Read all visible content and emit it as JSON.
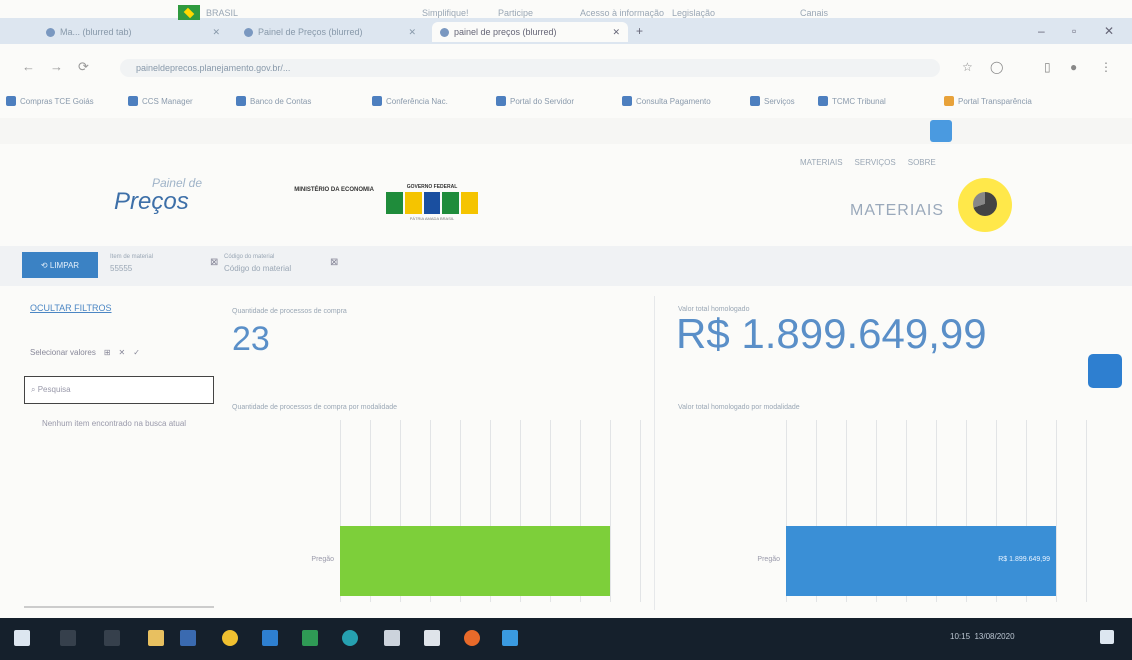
{
  "browser": {
    "tabs": [
      {
        "label": "Ma... (blurred tab)",
        "active": false
      },
      {
        "label": "Painel de Preços (blurred)",
        "active": false
      },
      {
        "label": "painel de preços (blurred)",
        "active": true
      }
    ],
    "url": "paineldeprecos.planejamento.gov.br/...",
    "bookmarks": [
      "Compras TCE Goiás",
      "CCS Manager",
      "Banco de Contas",
      "Conferência Nac.",
      "Portal do Servidor",
      "Consulta Pagamento",
      "Serviços",
      "TCMC Tribunal",
      "Portal Transparência"
    ]
  },
  "gov_bar": {
    "country_label": "BRASIL",
    "links": [
      "Simplifique!",
      "Participe",
      "Acesso à informação",
      "Legislação",
      "Canais"
    ]
  },
  "header": {
    "logo_top": "Painel de",
    "logo_main": "Preços",
    "ministry": "MINISTÉRIO DA ECONOMIA",
    "govt": "GOVERNO FEDERAL",
    "govt_sub": "PÁTRIA AMADA BRASIL",
    "top_links": [
      "MATERIAIS",
      "SERVIÇOS",
      "SOBRE"
    ],
    "section": "MATERIAIS"
  },
  "filters": {
    "clear_label": "LIMPAR",
    "chips": [
      {
        "title": "Item de material",
        "value": "55555"
      },
      {
        "title": "Código do material",
        "value": "Código do material"
      }
    ]
  },
  "left_panel": {
    "hide_filters": "OCULTAR FILTROS",
    "select_label": "Selecionar valores",
    "search_placeholder": "Pesquisa",
    "empty_message": "Nenhum item encontrado na busca atual"
  },
  "cards": {
    "count_title": "Quantidade de processos de compra",
    "count_value": "23",
    "value_title": "Valor total homologado",
    "value_value": "R$ 1.899.649,99"
  },
  "chart_data": [
    {
      "type": "bar",
      "title": "Quantidade de processos de compra por modalidade",
      "categories": [
        "Pregão"
      ],
      "values": [
        23
      ],
      "orientation": "horizontal"
    },
    {
      "type": "bar",
      "title": "Valor total homologado por modalidade",
      "categories": [
        "Pregão"
      ],
      "values": [
        1899649.99
      ],
      "value_label": "R$ 1.899.649,99",
      "orientation": "horizontal"
    }
  ],
  "taskbar": {
    "time": "10:15",
    "date": "13/08/2020"
  },
  "colors": {
    "accent": "#3b82c4",
    "green_bar": "#7dcf3a",
    "blue_bar": "#3a8fd6",
    "yellow": "#ffe84a"
  }
}
